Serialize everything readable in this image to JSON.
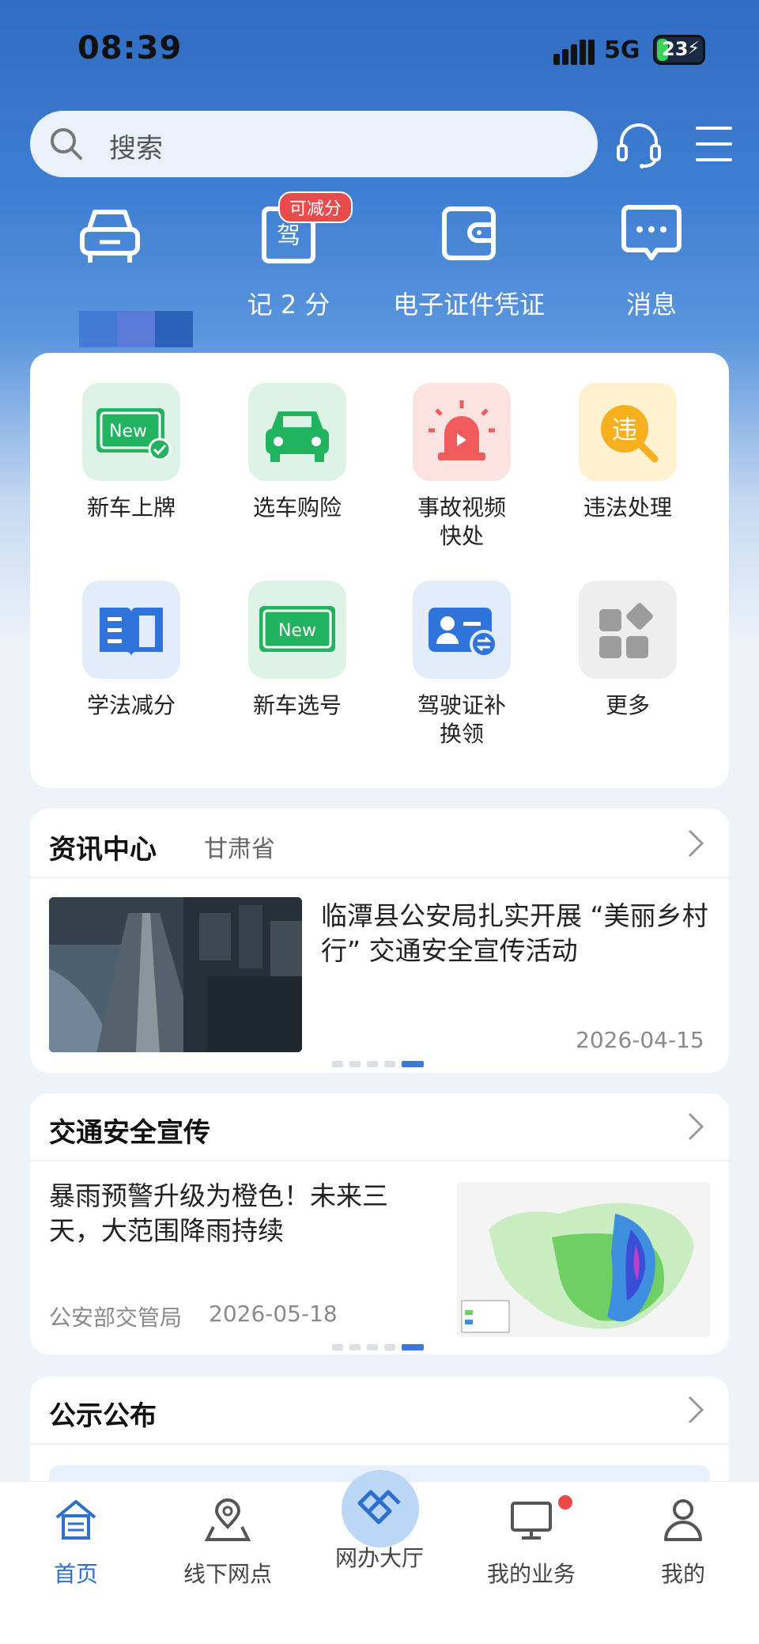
{
  "status_bar": {
    "time": "08:39",
    "network": "5G",
    "battery": "23"
  },
  "search": {
    "placeholder": "搜索"
  },
  "quick_actions": [
    {
      "label": "",
      "icon": "car-icon"
    },
    {
      "label": "记 2 分",
      "icon": "drive-license-icon",
      "badge": "可减分",
      "badge_char": "驾"
    },
    {
      "label": "电子证件凭证",
      "icon": "wallet-icon"
    },
    {
      "label": "消息",
      "icon": "message-icon"
    }
  ],
  "services": [
    {
      "label": "新车上牌",
      "icon": "new-plate-icon",
      "tag": "New"
    },
    {
      "label": "选车购险",
      "icon": "car-insurance-icon"
    },
    {
      "label": "事故视频\n快处",
      "icon": "alarm-icon"
    },
    {
      "label": "违法处理",
      "icon": "violation-icon",
      "char": "违"
    },
    {
      "label": "学法减分",
      "icon": "book-icon"
    },
    {
      "label": "新车选号",
      "icon": "number-select-icon",
      "tag": "New"
    },
    {
      "label": "驾驶证补\n换领",
      "icon": "license-renew-icon"
    },
    {
      "label": "更多",
      "icon": "more-icon"
    }
  ],
  "news": {
    "title": "资讯中心",
    "region": "甘肃省",
    "item_title": "临潭县公安局扎实开展 “美丽乡村行” 交通安全宣传活动",
    "date": "2026-04-15"
  },
  "safety": {
    "title": "交通安全宣传",
    "item_title": "暴雨预警升级为橙色！未来三天，大范围降雨持续",
    "source": "公安部交管局",
    "date": "2026-05-18"
  },
  "notice": {
    "title": "公示公布"
  },
  "tabs": [
    {
      "label": "首页",
      "icon": "home-icon",
      "active": true
    },
    {
      "label": "线下网点",
      "icon": "location-icon"
    },
    {
      "label": "网办大厅",
      "icon": "online-hall-icon"
    },
    {
      "label": "我的业务",
      "icon": "monitor-icon",
      "has_dot": true
    },
    {
      "label": "我的",
      "icon": "user-icon"
    }
  ],
  "colors": {
    "primary": "#2d6fcf",
    "badge": "#e74c4c",
    "green": "#22b35e"
  }
}
